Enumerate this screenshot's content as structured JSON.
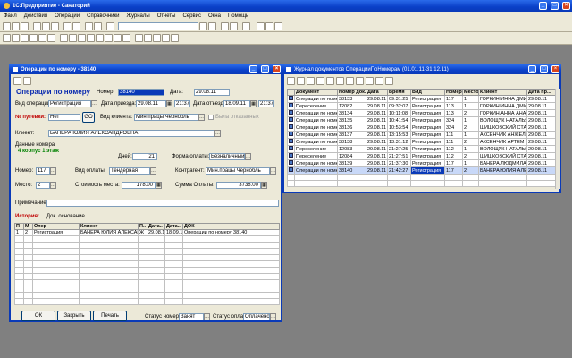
{
  "app": {
    "title": "1С:Предприятие - Санаторий"
  },
  "menu": [
    "Файл",
    "Действия",
    "Операции",
    "Справочники",
    "Журналы",
    "Отчеты",
    "Сервис",
    "Окна",
    "Помощь"
  ],
  "form": {
    "title": "Операции по номеру - 38140",
    "header": "Операции по номеру",
    "number_label": "Номер:",
    "number_value": "38140",
    "date_label": "Дата:",
    "date_value": "29.08.11",
    "optype_label": "Вид операции:",
    "optype_value": "Регистрация",
    "arrival_label": "Дата приезда:",
    "arrival_date": "29.08.11",
    "arrival_time": "21:37",
    "departure_label": "Дата отъезда:",
    "departure_date": "18.09.11",
    "departure_time": "21:37",
    "voucher_label": "№ путевки:",
    "voucher_value": "Нет",
    "go_label": "GO",
    "client_type_label": "Вид клиента:",
    "client_type_value": "Мин.працы Чернобль",
    "canceled_label": "Была отказанных",
    "client_label": "Клиент:",
    "client_value": "БАНЕРА ЮЛИЯ АЛЕКСАНДРОВНА",
    "room_data_label": "Данные номера",
    "room_desc": "4 корпус 1 этаж",
    "days_label": "Дней:",
    "days_value": "21",
    "payform_label": "Форма оплаты:",
    "payform_value": "Безналичный",
    "roomno_label": "Номер:",
    "roomno_value": "117",
    "paytype_label": "Вид оплаты:",
    "paytype_value": "Тендерная",
    "contractor_label": "Контрагент:",
    "contractor_value": "Мин.працы Чернобль",
    "place_label": "Место:",
    "place_value": "2",
    "cost_label": "Стоимость места:",
    "cost_value": "178.00",
    "sum_label": "Сумма Оплаты:",
    "sum_value": "3738.00",
    "note_label": "Примечание:",
    "history_label": "История:",
    "basis_label": "Док. основание",
    "history_columns": [
      "П",
      "М",
      "Опер",
      "Клиент",
      "П..",
      "Дата..",
      "Дата..",
      "ДОК"
    ],
    "history_rows": [
      [
        "1",
        "2",
        "Регистрация",
        "БАНЕРА ЮЛИЯ АЛЕКСАНД...",
        "Ж",
        "29.08.11",
        "18.09.11",
        "Операции по номеру 38140"
      ]
    ],
    "ok_label": "ОК",
    "close_label": "Закрыть",
    "print_label": "Печать",
    "room_status_label": "Статус номера:",
    "room_status_value": "Занят",
    "pay_status_label": "Статус оплаты:",
    "pay_status_value": "Оплачено"
  },
  "journal": {
    "title": "Журнал документов ОперацииПоНомерам (01.01.11-31.12.11)",
    "columns": [
      "",
      "Документ",
      "Номер док.",
      "Дата",
      "Время",
      "Вид",
      "Номер",
      "Место",
      "Клиент",
      "Дата пр..."
    ],
    "rows": [
      [
        "Операции по номеру",
        "38133",
        "29.08.11",
        "09:31:25",
        "Регистрация",
        "117",
        "1",
        "ГОРКИН ИННА ДМИ",
        "29.08.11"
      ],
      [
        "Переселение",
        "12082",
        "29.08.11",
        "09:32:07",
        "Регистрация",
        "113",
        "1",
        "ГОРКИН ИННА ДМИ",
        "29.08.11"
      ],
      [
        "Операции по номеру",
        "38134",
        "29.08.11",
        "10:11:08",
        "Регистрация",
        "113",
        "2",
        "ГОРКИН АННА АНАТ",
        "29.08.11"
      ],
      [
        "Операции по номеру",
        "38135",
        "29.08.11",
        "10:41:54",
        "Регистрация",
        "324",
        "1",
        "ВОЛОЩУК НАТАЛЬЯ",
        "29.08.11"
      ],
      [
        "Операции по номеру",
        "38136",
        "29.08.11",
        "10:53:54",
        "Регистрация",
        "324",
        "2",
        "ШИШКОВСКИЙ СТАН",
        "29.08.11"
      ],
      [
        "Операции по номеру",
        "38137",
        "29.08.11",
        "13:15:53",
        "Регистрация",
        "111",
        "1",
        "АКСЕНЧИК АНЖЕЛА",
        "29.08.11"
      ],
      [
        "Операции по номеру",
        "38138",
        "29.08.11",
        "13:31:12",
        "Регистрация",
        "111",
        "2",
        "АКСЕНЧИК АРТЕМ С",
        "29.08.11"
      ],
      [
        "Переселение",
        "12083",
        "29.08.11",
        "21:27:25",
        "Регистрация",
        "112",
        "1",
        "ВОЛОЩУК НАТАЛЬЯ",
        "29.08.11"
      ],
      [
        "Переселение",
        "12084",
        "29.08.11",
        "21:27:51",
        "Регистрация",
        "112",
        "2",
        "ШИШКОВСКИЙ СТАН",
        "29.08.11"
      ],
      [
        "Операции по номеру",
        "38139",
        "29.08.11",
        "21:37:30",
        "Регистрация",
        "117",
        "1",
        "БАНЕРА ЛЮДМИЛА",
        "29.08.11"
      ],
      [
        "Операции по номеру",
        "38140",
        "29.08.11",
        "21:42:27",
        "Регистрация",
        "117",
        "2",
        "БАНЕРА ЮЛИЯ АЛЕ",
        "29.08.11"
      ]
    ]
  }
}
